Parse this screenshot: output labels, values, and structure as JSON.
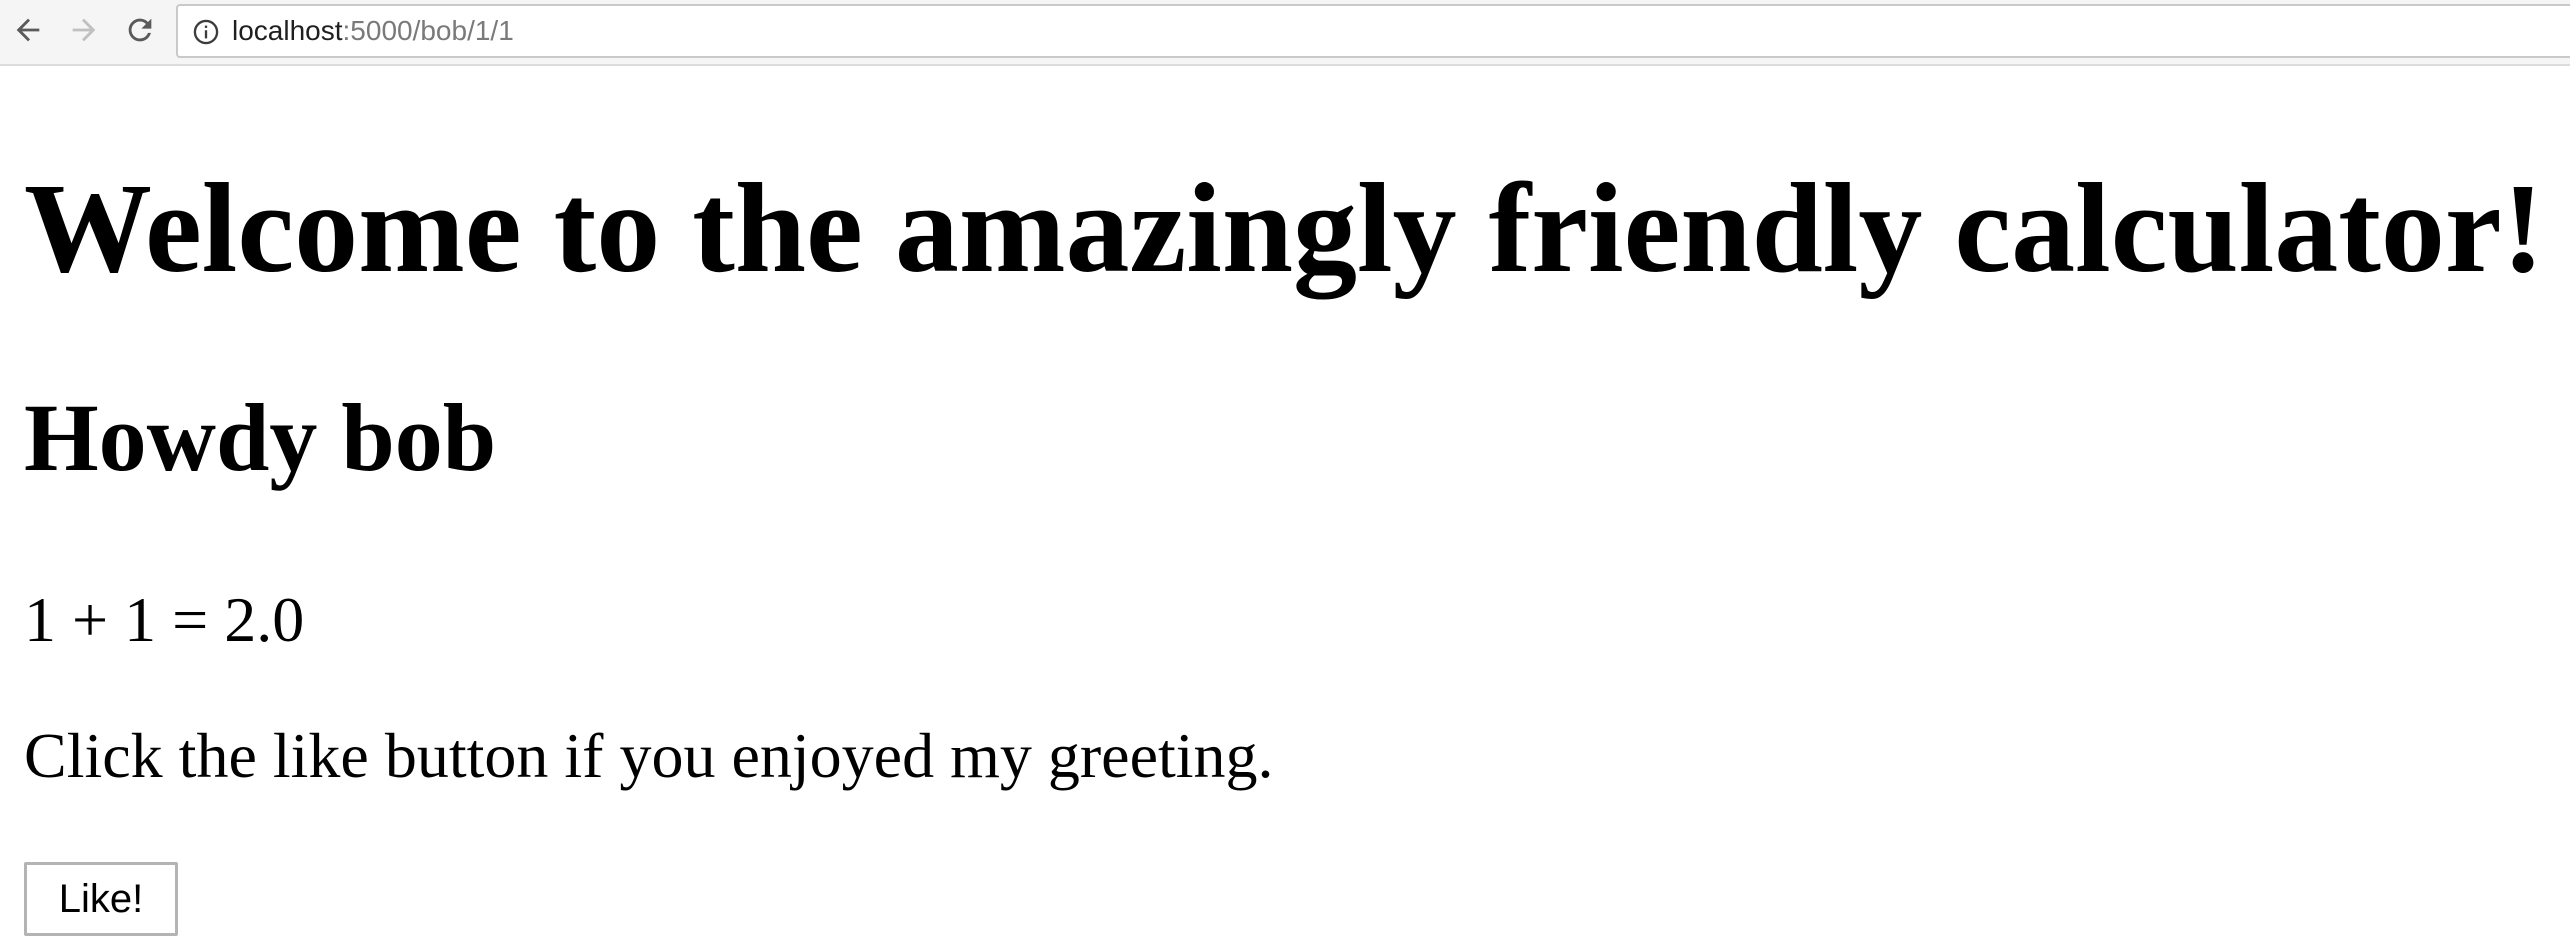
{
  "browser": {
    "url_host": "localhost",
    "url_rest": ":5000/bob/1/1",
    "icons": {
      "back": "arrow-left-icon",
      "forward": "arrow-right-icon",
      "reload": "reload-icon",
      "site_info": "info-icon"
    },
    "colors": {
      "toolbar_bg": "#f5f5f5",
      "disabled_icon": "#c0c0c0",
      "active_icon": "#5a5a5a"
    }
  },
  "page": {
    "heading": "Welcome to the amazingly friendly calculator!",
    "greeting": "Howdy bob",
    "result": "1 + 1 = 2.0",
    "like_prompt": "Click the like button if you enjoyed my greeting.",
    "like_button_label": "Like!"
  }
}
